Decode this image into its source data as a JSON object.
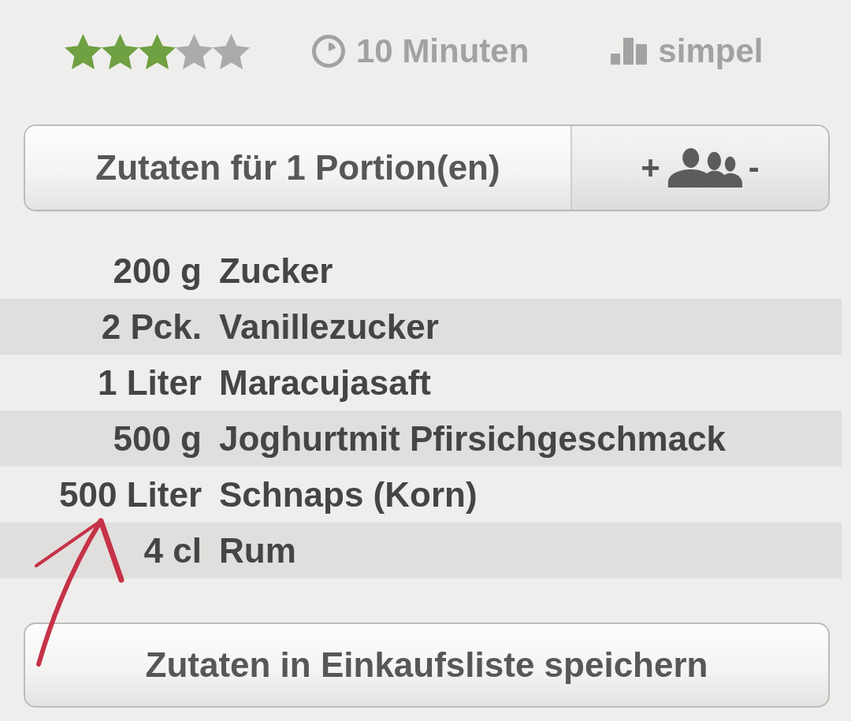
{
  "rating": {
    "stars": 3
  },
  "meta": [
    {
      "kind": "time",
      "text": "10 Minuten"
    },
    {
      "kind": "difficulty",
      "text": "simpel"
    }
  ],
  "portions": {
    "label": "Zutaten für 1 Portion(en)",
    "increase": "+",
    "decrease": "-"
  },
  "ingredients": [
    {
      "amount": "200 g",
      "name": "Zucker"
    },
    {
      "amount": "2 Pck.",
      "name": "Vanillezucker"
    },
    {
      "amount": "1 Liter",
      "name": "Maracujasaft"
    },
    {
      "amount": "500 g",
      "name": "Joghurtmit Pfirsichgeschmack"
    },
    {
      "amount": "500 Liter",
      "name": "Schnaps (Korn)"
    },
    {
      "amount": "4 cl",
      "name": "Rum"
    }
  ],
  "annotation": {
    "kind": "arrow"
  },
  "save_button": {
    "label": "Zutaten in Einkaufsliste speichern"
  }
}
